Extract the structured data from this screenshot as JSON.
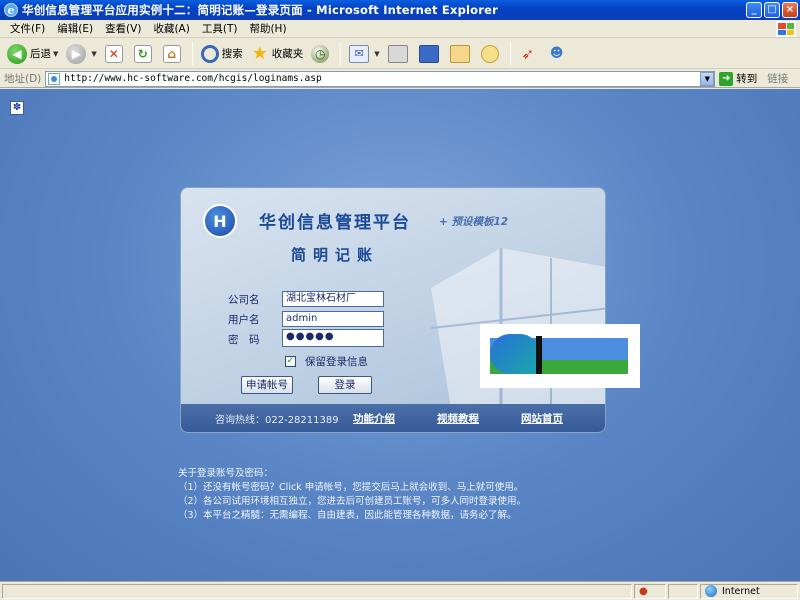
{
  "window": {
    "title": "华创信息管理平台应用实例十二：简明记账—登录页面 - Microsoft Internet Explorer",
    "buttons": {
      "minimize": "_",
      "maximize": "□",
      "close": "×"
    }
  },
  "menu": [
    "文件(F)",
    "编辑(E)",
    "查看(V)",
    "收藏(A)",
    "工具(T)",
    "帮助(H)"
  ],
  "toolbar": {
    "back": "后退",
    "search": "搜索",
    "favorites": "收藏夹"
  },
  "address": {
    "label": "地址(D)",
    "url": "http://www.hc-software.com/hcgis/loginams.asp",
    "go": "转到",
    "links": "链接"
  },
  "login": {
    "platform_name": "华创信息管理平台",
    "platform_sub": "+ 预设模板12",
    "app_name": "简明记账",
    "company_label": "公司名",
    "company_value": "湖北宝林石材厂",
    "username_label": "用户名",
    "username_value": "admin",
    "password_label": "密　码",
    "password_value": "●●●●●",
    "remember_label": "保留登录信息",
    "remember_checked": true,
    "apply_button": "申请帐号",
    "login_button": "登录",
    "hotline": "咨询热线：022-28211389",
    "footer_links": [
      "功能介绍",
      "视频教程",
      "网站首页"
    ]
  },
  "notes": [
    "关于登录账号及密码：",
    "（1）还没有帐号密码？Click 申请帐号，您提交后马上就会收到、马上就可使用。",
    "（2）各公司试用环境相互独立，您进去后可创建员工账号，可多人同时登录使用。",
    "（3）本平台之精髓：无需编程、自由建表，因此能管理各种数据，请务必了解。"
  ],
  "status": {
    "zone": "Internet"
  }
}
